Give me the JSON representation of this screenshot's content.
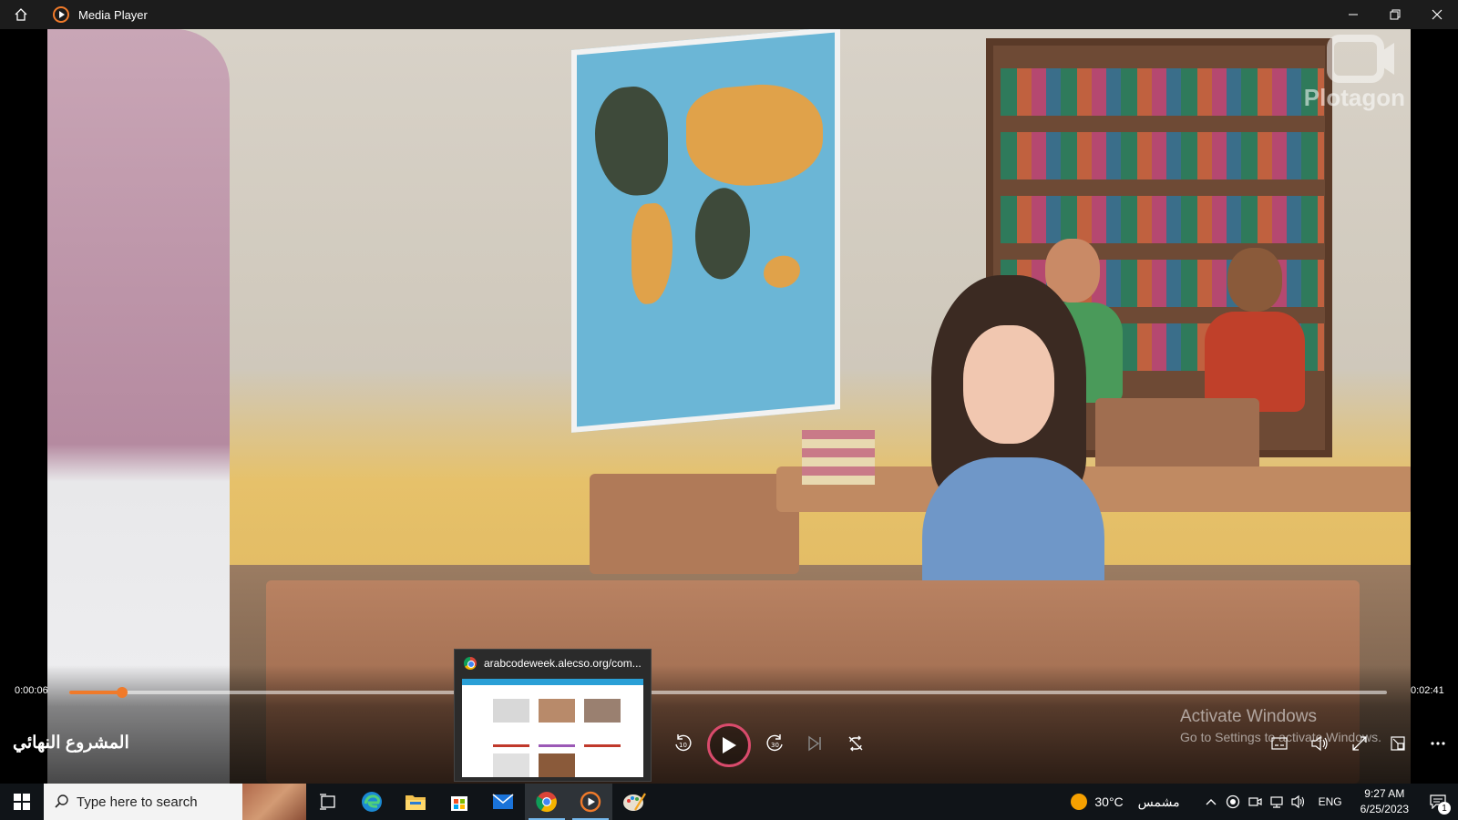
{
  "window": {
    "title": "Media Player"
  },
  "video": {
    "watermark": "Plotagon"
  },
  "player": {
    "current_time": "0:00:06",
    "total_time": "0:02:41",
    "progress_fraction": 0.04,
    "media_title": "المشروع النهائي",
    "accent": "#f07a2a"
  },
  "activation": {
    "line1": "Activate Windows",
    "line2": "Go to Settings to activate Windows."
  },
  "preview": {
    "title": "arabcodeweek.alecso.org/com..."
  },
  "taskbar": {
    "search_placeholder": "Type here to search",
    "apps": [
      "task-view",
      "edge",
      "file-explorer",
      "microsoft-store",
      "mail",
      "chrome",
      "media-player",
      "paint"
    ],
    "weather_temp": "30°C",
    "weather_text": "مشمس",
    "language": "ENG",
    "time": "9:27 AM",
    "date": "6/25/2023",
    "notification_count": "1"
  }
}
